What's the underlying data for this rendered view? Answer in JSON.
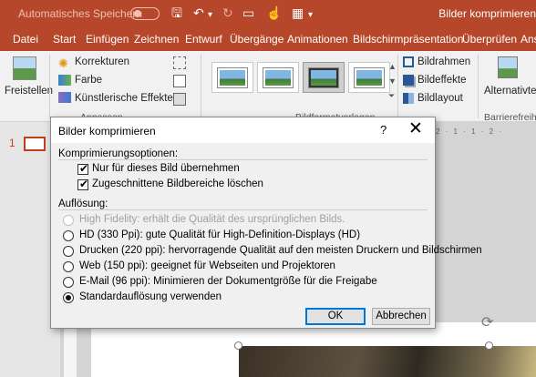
{
  "titlebar": {
    "autosave_label": "Automatisches Speichern",
    "doc_title": "Bilder komprimieren"
  },
  "tabs": [
    "Datei",
    "Start",
    "Einfügen",
    "Zeichnen",
    "Entwurf",
    "Übergänge",
    "Animationen",
    "Bildschirmpräsentation",
    "Überprüfen",
    "Ansi"
  ],
  "ribbon": {
    "freistellen": "Freistellen",
    "korrekturen": "Korrekturen",
    "farbe": "Farbe",
    "kuenstlerisch": "Künstlerische Effekte",
    "group_anpassen": "Anpassen",
    "group_bildformatvorlagen": "Bildformatvorlagen",
    "bildrahmen": "Bildrahmen",
    "bildeffekte": "Bildeffekte",
    "bildlayout": "Bildlayout",
    "alternativtext": "Alternativtex",
    "group_barrierefreiheit": "Barrierefreihe"
  },
  "workspace": {
    "slide_number": "1",
    "ruler_marks": "2 · 1 · 1 · 2 ·"
  },
  "dialog": {
    "title": "Bilder komprimieren",
    "help": "?",
    "close": "✕",
    "section_compression": "Komprimierungsoptionen:",
    "check_only_this": "Nur für dieses Bild übernehmen",
    "check_delete_cropped": "Zugeschnittene Bildbereiche löschen",
    "section_resolution": "Auflösung:",
    "options": [
      {
        "label": "High Fidelity: erhält die Qualität des ursprünglichen Bilds.",
        "selected": false,
        "disabled": true
      },
      {
        "label": "HD (330 Ppi): gute Qualität für High-Definition-Displays (HD)",
        "selected": false,
        "disabled": false
      },
      {
        "label": "Drucken (220 ppi): hervorragende Qualität auf den meisten Druckern und Bildschirmen",
        "selected": false,
        "disabled": false
      },
      {
        "label": "Web (150 ppi): geeignet für Webseiten und Projektoren",
        "selected": false,
        "disabled": false
      },
      {
        "label": "E-Mail (96 ppi): Minimieren der Dokumentgröße für die Freigabe",
        "selected": false,
        "disabled": false
      },
      {
        "label": "Standardauflösung verwenden",
        "selected": true,
        "disabled": false
      }
    ],
    "ok": "OK",
    "cancel": "Abbrechen"
  }
}
